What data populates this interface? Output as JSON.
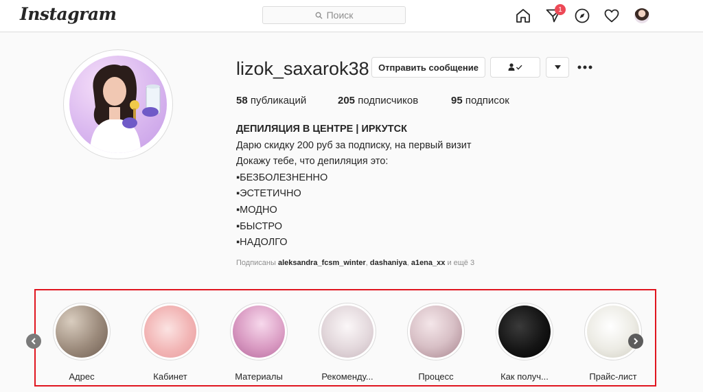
{
  "topbar": {
    "logo_text": "Instagram",
    "search_placeholder": "Поиск",
    "notification_count": "1"
  },
  "profile": {
    "username": "lizok_saxarok38",
    "message_button": "Отправить сообщение",
    "stats": [
      {
        "count": "58",
        "label": "публикаций"
      },
      {
        "count": "205",
        "label": "подписчиков"
      },
      {
        "count": "95",
        "label": "подписок"
      }
    ],
    "bio": {
      "name": "ДЕПИЛЯЦИЯ В ЦЕНТРЕ | ИРКУТСК",
      "lines": [
        "Дарю скидку 200 руб за подписку, на первый визит",
        "Докажу тебе, что депиляция это:",
        "▪БЕЗБОЛЕЗНЕННО",
        "▪ЭСТЕТИЧНО",
        "▪МОДНО",
        "▪БЫСТРО",
        "▪НАДОЛГО"
      ]
    },
    "followed_by": {
      "prefix": "Подписаны",
      "users": [
        "aleksandra_fcsm_winter",
        "dashaniya",
        "a1ena_xx"
      ],
      "suffix": "и ещё 3"
    }
  },
  "highlights": [
    {
      "label": "Адрес",
      "color": "#9c8b7c"
    },
    {
      "label": "Кабинет",
      "color": "#f2b5b5"
    },
    {
      "label": "Материалы",
      "color": "#d99ac2"
    },
    {
      "label": "Рекоменду...",
      "color": "#e3d8dc"
    },
    {
      "label": "Процесс",
      "color": "#d8c0c6"
    },
    {
      "label": "Как получ...",
      "color": "#151515"
    },
    {
      "label": "Прайс-лист",
      "color": "#ecebe4"
    }
  ],
  "colors": {
    "highlight_frame": "#e0141e",
    "badge": "#ed4956"
  }
}
